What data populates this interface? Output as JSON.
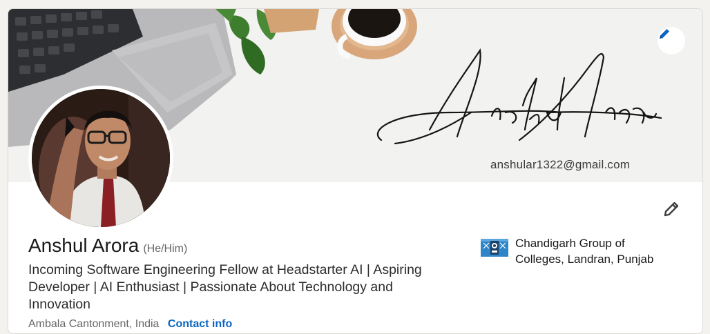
{
  "banner": {
    "signature_text": "Anshul Arora",
    "email": "anshular1322@gmail.com",
    "edit_icon": "pencil-icon"
  },
  "profile": {
    "name": "Anshul Arora",
    "pronouns": "(He/Him)",
    "headline": "Incoming Software Engineering Fellow at Headstarter AI | Aspiring Developer | AI Enthusiast | Passionate About Technology and Innovation",
    "location": "Ambala Cantonment, India",
    "contact_link": "Contact info",
    "edit_icon": "pencil-icon"
  },
  "education": {
    "name": "Chandigarh Group of Colleges, Landran, Punjab"
  },
  "colors": {
    "accent": "#0a66c2",
    "text_primary": "#191919",
    "text_secondary": "#666666"
  }
}
